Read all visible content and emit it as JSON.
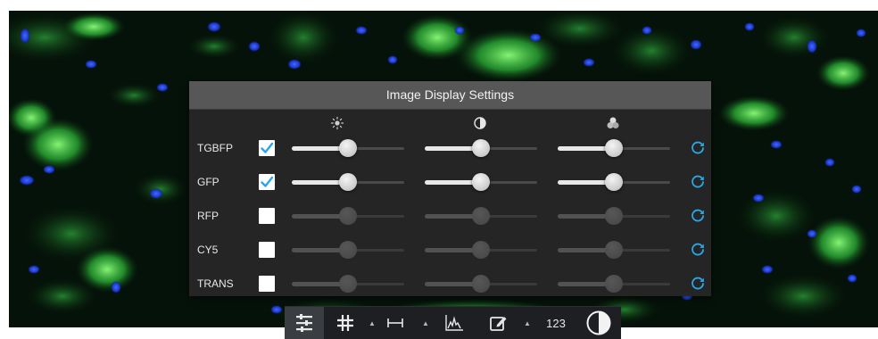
{
  "panel": {
    "title": "Image Display Settings",
    "column_icons": [
      "brightness-icon",
      "contrast-icon",
      "color-mix-icon"
    ]
  },
  "channels": [
    {
      "label": "TGBFP",
      "checked": true,
      "brightness": 50,
      "contrast": 50,
      "color": 50
    },
    {
      "label": "GFP",
      "checked": true,
      "brightness": 50,
      "contrast": 50,
      "color": 50
    },
    {
      "label": "RFP",
      "checked": false,
      "brightness": 50,
      "contrast": 50,
      "color": 50
    },
    {
      "label": "CY5",
      "checked": false,
      "brightness": 50,
      "contrast": 50,
      "color": 50
    },
    {
      "label": "TRANS",
      "checked": false,
      "brightness": 50,
      "contrast": 50,
      "color": 50
    }
  ],
  "toolbar": {
    "counter_label": "123",
    "buttons": [
      "display-settings-icon",
      "grid-icon",
      "measure-icon",
      "histogram-icon",
      "annotate-icon",
      "counter",
      "contrast-toggle-icon"
    ]
  },
  "colors": {
    "accent": "#2aa7e8",
    "panel_bg": "#262626",
    "panel_header": "#575757",
    "toolbar_bg": "#1d1f22"
  }
}
